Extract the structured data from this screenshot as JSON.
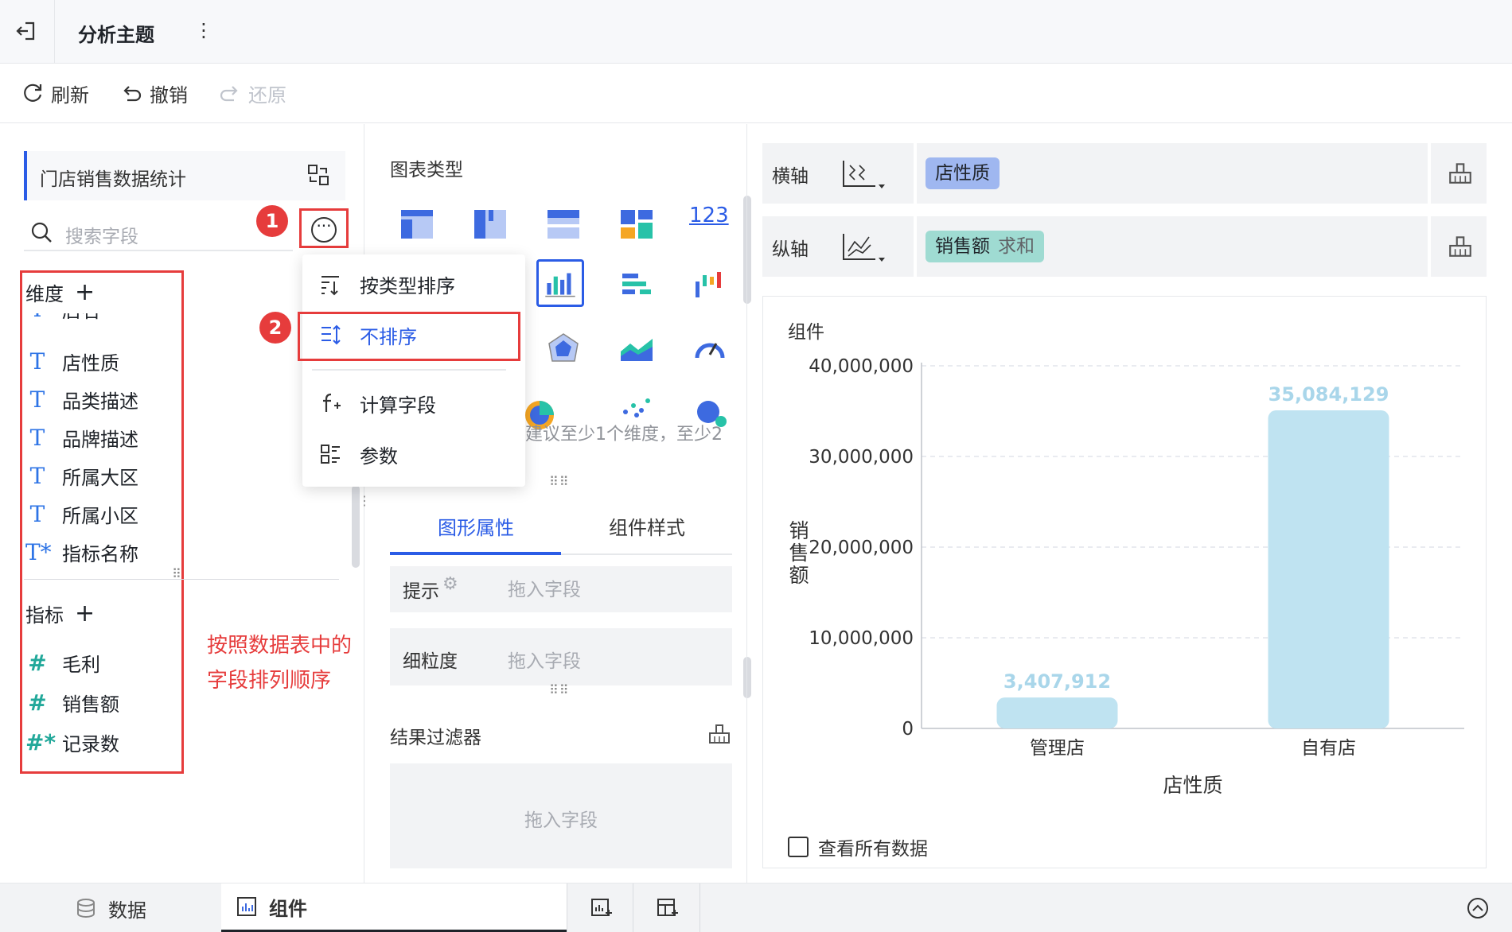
{
  "topbar": {
    "title": "分析主题",
    "more": "⋮"
  },
  "toolbar": {
    "refresh": "刷新",
    "undo": "撤销",
    "redo": "还原"
  },
  "left": {
    "dataset_name": "门店销售数据统计",
    "search_placeholder": "搜索字段",
    "dimension_title": "维度",
    "dimension_fields": [
      "店名",
      "店性质",
      "品类描述",
      "品牌描述",
      "所属大区",
      "所属小区",
      "指标名称"
    ],
    "measure_title": "指标",
    "measure_fields": [
      "毛利",
      "销售额",
      "记录数"
    ],
    "note_line1": "按照数据表中的",
    "note_line2": "字段排列顺序",
    "add_symbol": "+"
  },
  "badges": [
    "1",
    "2"
  ],
  "menu": {
    "items": [
      "按类型排序",
      "不排序",
      "计算字段",
      "参数"
    ]
  },
  "middle": {
    "chart_type_title": "图表类型",
    "number_icon": "123",
    "hint": "建议至少1个维度，至少2",
    "tabs": [
      "图形属性",
      "组件样式"
    ],
    "prop_tooltip": "提示",
    "prop_granularity": "细粒度",
    "drag_field": "拖入字段",
    "filter_title": "结果过滤器"
  },
  "right": {
    "x_axis_label": "横轴",
    "y_axis_label": "纵轴",
    "x_field": "店性质",
    "y_field": "销售额",
    "y_agg": "求和",
    "component_title": "组件",
    "view_all": "查看所有数据"
  },
  "bottom": {
    "tab_data": "数据",
    "tab_component": "组件"
  },
  "colors": {
    "accent": "#2b5ce6",
    "bar": "#bfe3f1",
    "annotation": "#e63c3c"
  },
  "chart_data": {
    "type": "bar",
    "categories": [
      "管理店",
      "自有店"
    ],
    "values": [
      3407912,
      35084129
    ],
    "value_labels": [
      "3,407,912",
      "35,084,129"
    ],
    "xlabel": "店性质",
    "ylabel": "销售额",
    "ylim": [
      0,
      40000000
    ],
    "yticks": [
      "0",
      "10,000,000",
      "20,000,000",
      "30,000,000",
      "40,000,000"
    ],
    "grid": true
  }
}
